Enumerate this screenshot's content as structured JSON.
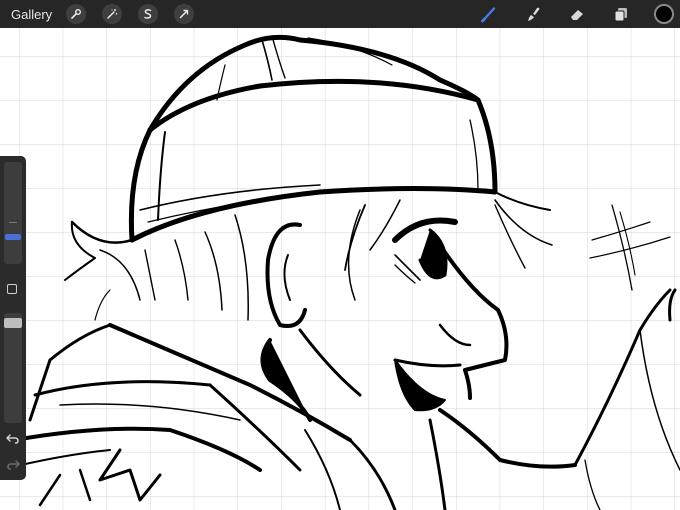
{
  "topbar": {
    "gallery_label": "Gallery",
    "left_tools": [
      "wrench-icon",
      "magic-wand-icon",
      "selection-icon",
      "transform-arrow-icon"
    ],
    "right_tools": [
      "brush-icon",
      "smudge-icon",
      "eraser-icon",
      "layers-icon"
    ],
    "active_tool": "brush-icon",
    "active_color": "#000000",
    "accent_color": "#4a7be0"
  },
  "sidebar": {
    "brush_size_level": 0.25,
    "opacity_level": 0.95,
    "modify_button_icon": "square-icon",
    "undo_icon": "undo-arrow-icon",
    "redo_icon": "redo-arrow-icon"
  },
  "canvas": {
    "background": "#ffffff",
    "grid_color": "#d6d6d6",
    "line_color": "#000000"
  }
}
